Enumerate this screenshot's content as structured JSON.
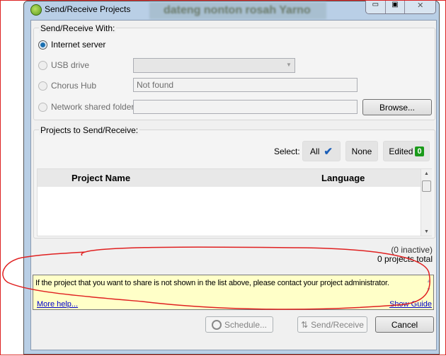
{
  "window": {
    "title": "Send/Receive Projects",
    "background_text": "dateng nonton rosah Yarno"
  },
  "send_with": {
    "label": "Send/Receive With:",
    "options": [
      {
        "label": "Internet server",
        "selected": true
      },
      {
        "label": "USB drive",
        "selected": false
      },
      {
        "label": "Chorus Hub",
        "selected": false
      },
      {
        "label": "Network shared folder",
        "selected": false
      }
    ],
    "chorus_hub_value": "Not found",
    "usb_value": "",
    "network_value": "",
    "browse_label": "Browse..."
  },
  "projects": {
    "label": "Projects to Send/Receive:",
    "select_label": "Select:",
    "all_label": "All",
    "none_label": "None",
    "edited_label": "Edited",
    "edited_count": "0",
    "columns": [
      "Project Name",
      "Language"
    ],
    "rows": []
  },
  "counts": {
    "inactive": "(0 inactive)",
    "total": "0 projects total"
  },
  "help": {
    "message": "If the project that you want to share is not shown in the list above, please contact your project administrator.",
    "more_help": "More help...",
    "show_guide": "Show Guide"
  },
  "buttons": {
    "schedule": "Schedule...",
    "send_receive": "Send/Receive",
    "cancel": "Cancel"
  },
  "colors": {
    "annotation": "#e02020",
    "help_bg": "#ffffc8",
    "check": "#1c5fb8",
    "badge": "#1a9a1a"
  }
}
